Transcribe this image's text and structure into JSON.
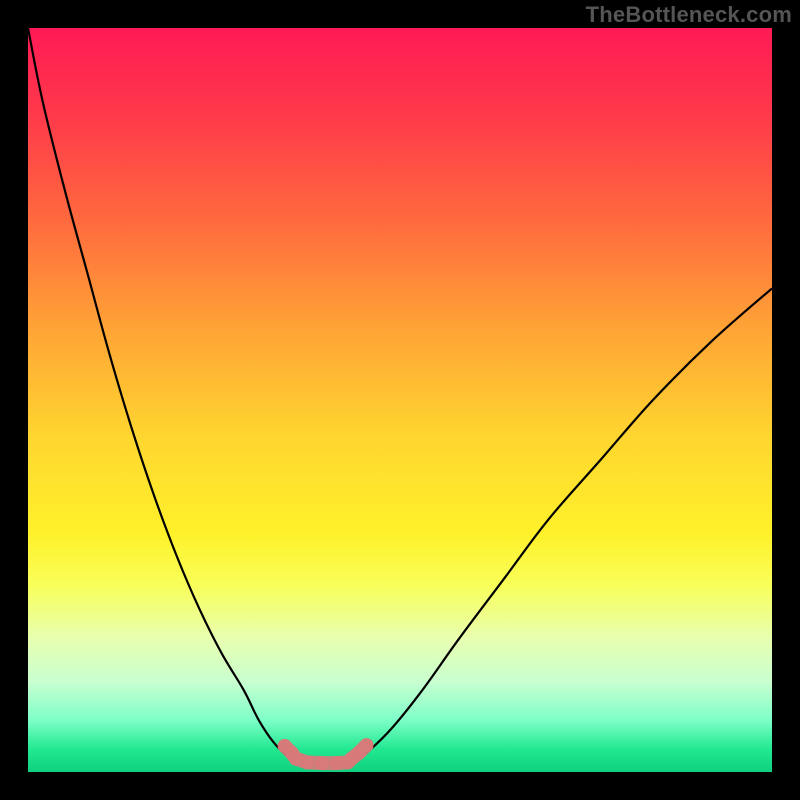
{
  "watermark": "TheBottleneck.com",
  "chart_data": {
    "type": "line",
    "title": "",
    "xlabel": "",
    "ylabel": "",
    "xlim": [
      0,
      100
    ],
    "ylim": [
      0,
      100
    ],
    "grid": false,
    "legend": false,
    "series": [
      {
        "name": "curve-left",
        "color": "#000000",
        "x": [
          0,
          2,
          5,
          8,
          11,
          14,
          17,
          20,
          23,
          26,
          29,
          31,
          33,
          35,
          36
        ],
        "y": [
          100,
          90,
          78,
          67,
          56,
          46,
          37,
          29,
          22,
          16,
          11,
          7,
          4,
          2,
          1.5
        ]
      },
      {
        "name": "curve-right",
        "color": "#000000",
        "x": [
          44,
          46,
          49,
          53,
          58,
          64,
          70,
          77,
          84,
          92,
          100
        ],
        "y": [
          1.5,
          3,
          6,
          11,
          18,
          26,
          34,
          42,
          50,
          58,
          65
        ]
      },
      {
        "name": "highlight-marks",
        "color": "#d87a7a",
        "x": [
          34.5,
          35.5,
          36,
          37.5,
          39.5,
          41.5,
          43,
          43.5,
          44.5,
          45.5
        ],
        "y": [
          3.5,
          2.5,
          1.8,
          1.3,
          1.2,
          1.2,
          1.3,
          1.8,
          2.6,
          3.6
        ]
      }
    ],
    "palette": {
      "gradient_top": "#ff1a55",
      "gradient_mid": "#ffd62f",
      "gradient_bottom": "#10d080",
      "frame": "#000000",
      "highlight": "#d87a7a"
    }
  }
}
